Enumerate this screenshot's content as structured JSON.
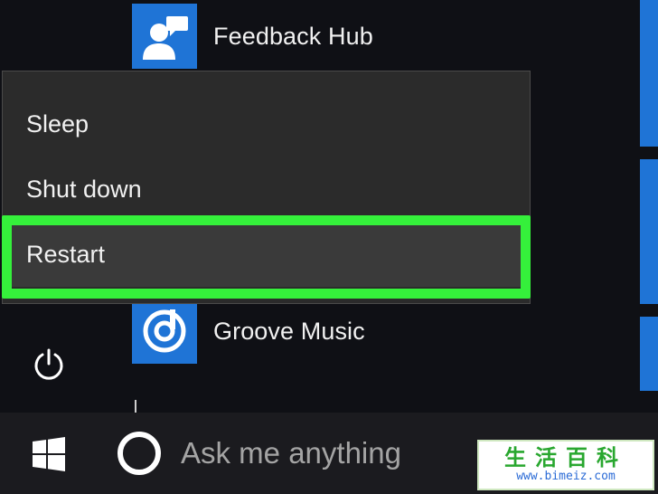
{
  "apps": [
    {
      "label": "Feedback Hub",
      "icon": "feedback-hub-icon"
    },
    {
      "label": "Groove Music",
      "icon": "groove-music-icon"
    }
  ],
  "power_menu": {
    "items": [
      {
        "label": "Sleep"
      },
      {
        "label": "Shut down"
      },
      {
        "label": "Restart"
      }
    ],
    "highlighted": "Restart",
    "highlight_color": "#35f03b"
  },
  "power_button": {
    "icon": "power-icon"
  },
  "taskbar": {
    "start_icon": "windows-logo-icon",
    "cortana_icon": "cortana-ring-icon",
    "search_placeholder": "Ask me anything"
  },
  "watermark": {
    "title": "生活百科",
    "url": "www.bimeiz.com"
  },
  "colors": {
    "tile_blue": "#1f74d6",
    "menu_bg": "#2b2b2b",
    "taskbar_bg": "#1b1b1f"
  }
}
